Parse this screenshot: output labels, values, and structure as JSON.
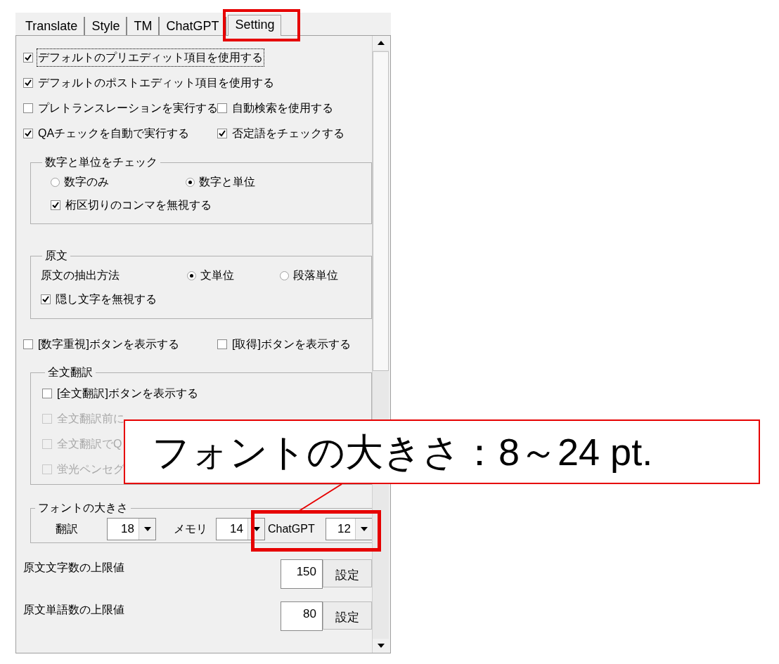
{
  "tabs": [
    {
      "label": "Translate",
      "selected": false
    },
    {
      "label": "Style",
      "selected": false
    },
    {
      "label": "TM",
      "selected": false
    },
    {
      "label": "ChatGPT",
      "selected": false
    },
    {
      "label": "Setting",
      "selected": true
    }
  ],
  "option_rows": [
    [
      {
        "label": "デフォルトのプリエディット項目を使用する",
        "checked": true,
        "focused": true
      }
    ],
    [
      {
        "label": "デフォルトのポストエディット項目を使用する",
        "checked": true,
        "focused": false
      }
    ],
    [
      {
        "label": "プレトランスレーションを実行する",
        "checked": false,
        "focused": false
      },
      {
        "label": "自動検索を使用する",
        "checked": false,
        "focused": false
      }
    ],
    [
      {
        "label": "QAチェックを自動で実行する",
        "checked": true,
        "focused": false
      },
      {
        "label": "否定語をチェックする",
        "checked": true,
        "focused": false
      }
    ]
  ],
  "number_unit_group": {
    "title": "数字と単位をチェック",
    "radios": [
      {
        "label": "数字のみ",
        "selected": false
      },
      {
        "label": "数字と単位",
        "selected": true
      }
    ],
    "checkbox": {
      "label": "桁区切りのコンマを無視する",
      "checked": true
    }
  },
  "source_group": {
    "title": "原文",
    "method_label": "原文の抽出方法",
    "radios": [
      {
        "label": "文単位",
        "selected": true
      },
      {
        "label": "段落単位",
        "selected": false
      }
    ],
    "checkbox": {
      "label": "隠し文字を無視する",
      "checked": true
    }
  },
  "button_options": [
    {
      "label": "[数字重視]ボタンを表示する",
      "checked": false
    },
    {
      "label": "[取得]ボタンを表示する",
      "checked": false
    }
  ],
  "full_translation_group": {
    "title": "全文翻訳",
    "options": [
      {
        "label": "[全文翻訳]ボタンを表示する",
        "checked": false,
        "disabled": false
      },
      {
        "label": "全文翻訳前に",
        "checked": false,
        "disabled": true
      },
      {
        "label": "全文翻訳でQ",
        "checked": false,
        "disabled": true
      },
      {
        "label": "蛍光ペンセグ",
        "checked": false,
        "disabled": true
      }
    ]
  },
  "font_size_group": {
    "title": "フォントの大きさ",
    "fields": [
      {
        "label": "翻訳",
        "value": "18"
      },
      {
        "label": "メモリ",
        "value": "14"
      },
      {
        "label": "ChatGPT",
        "value": "12"
      }
    ]
  },
  "limits": [
    {
      "label": "原文文字数の上限値",
      "value": "150",
      "button": "設定"
    },
    {
      "label": "原文単語数の上限値",
      "value": "80",
      "button": "設定"
    }
  ],
  "callout": {
    "text": "フォントの大きさ：8～24 pt."
  }
}
